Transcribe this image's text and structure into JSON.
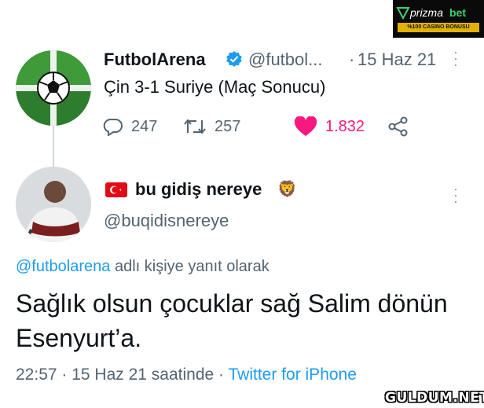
{
  "ad": {
    "brand": "prizmabet",
    "brand_part1": "prizma",
    "brand_part2": "bet",
    "tagline": "%100 CASINO BONUSU",
    "colors": {
      "background": "#0a0a0a",
      "accent": "#e2b007",
      "brand_green": "#3bd16f"
    }
  },
  "tweet1": {
    "name": "FutbolArena",
    "handle": "@futbol...",
    "separator": "·",
    "date": "15 Haz 21",
    "text": "Çin 3-1 Suriye (Maç Sonucu)",
    "verified_icon": "verified-badge-icon",
    "actions": {
      "replies": "247",
      "retweets": "257",
      "likes": "1.832"
    }
  },
  "tweet2": {
    "name": "bu gidiş nereye",
    "flag_icon": "turkey-flag-icon",
    "emoji": "🦁",
    "handle": "@buqidisnereye",
    "reply_prefix_mention": "@futbolarena",
    "reply_prefix_text": " adlı kişiye yanıt olarak",
    "text": "Sağlık olsun çocuklar sağ Salim dönün Esenyurt’a.",
    "meta_time": "22:57",
    "meta_sep1": " · ",
    "meta_date": "15 Haz 21 saatinde",
    "meta_sep2": " · ",
    "meta_source": "Twitter for iPhone"
  },
  "watermark": "GULDUM.NET",
  "colors": {
    "link": "#1d9bf0",
    "muted": "#536471",
    "like": "#f91880",
    "text": "#0f1419"
  }
}
